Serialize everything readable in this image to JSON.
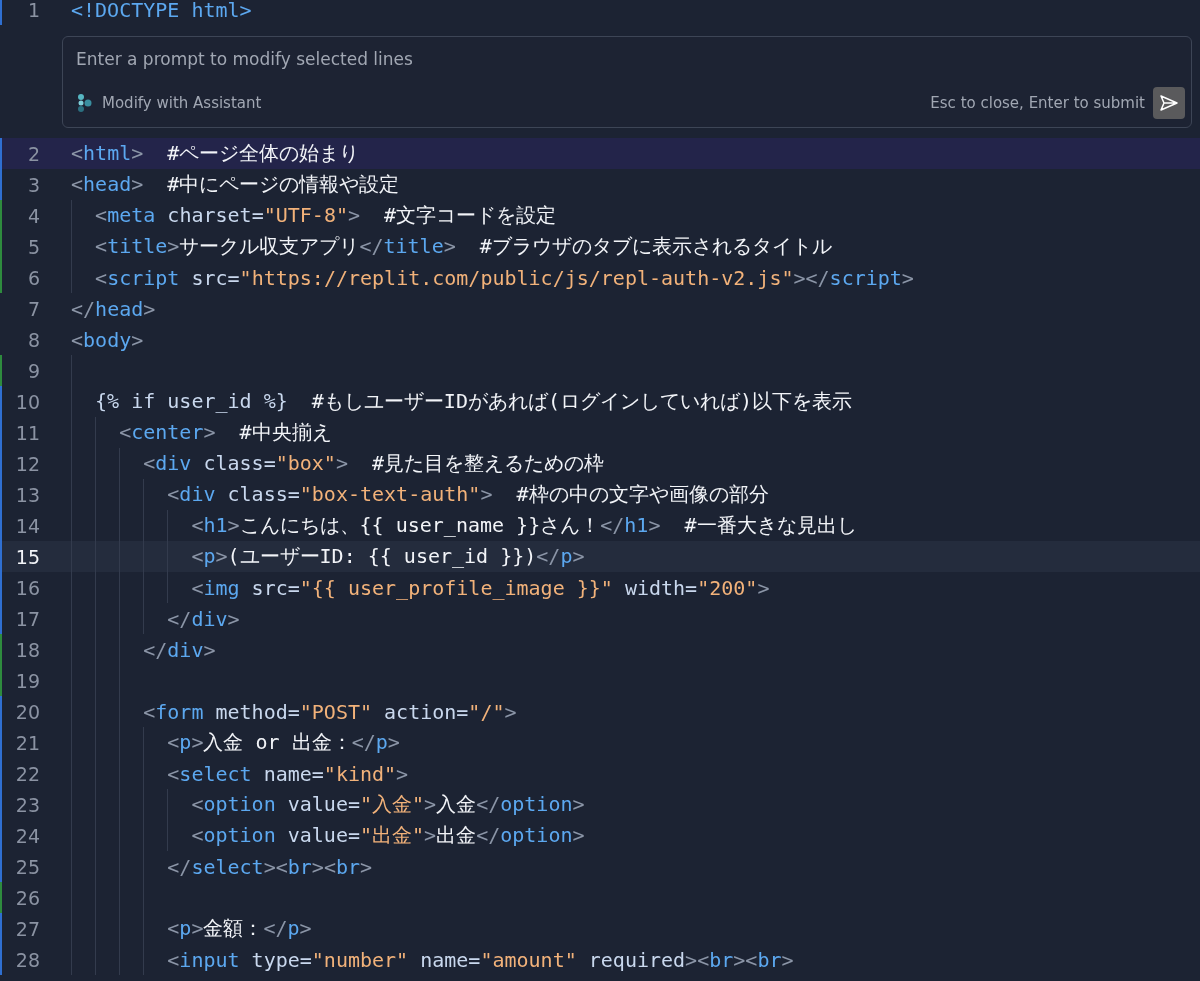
{
  "lines_before": [
    {
      "number": "1",
      "color": "#2f6fd1",
      "selected": false,
      "current": false,
      "tokens": [
        {
          "kind": "tag",
          "text": "<!DOCTYPE html>"
        }
      ]
    }
  ],
  "prompt": {
    "placeholder": "Enter a prompt to modify selected lines",
    "assistant_label": "Modify with Assistant",
    "hint": "Esc to close, Enter to submit"
  },
  "lines": [
    {
      "number": "2",
      "color": "#2f6fd1",
      "selected": true,
      "current": false,
      "tokens": [
        {
          "kind": "punct",
          "text": "<"
        },
        {
          "kind": "tag",
          "text": "html"
        },
        {
          "kind": "punct",
          "text": ">"
        },
        {
          "kind": "text",
          "text": "  #ページ全体の始まり"
        }
      ]
    },
    {
      "number": "3",
      "color": "#2f6fd1",
      "selected": false,
      "current": false,
      "tokens": [
        {
          "kind": "punct",
          "text": "<"
        },
        {
          "kind": "tag",
          "text": "head"
        },
        {
          "kind": "punct",
          "text": ">"
        },
        {
          "kind": "text",
          "text": "  #中にページの情報や設定"
        }
      ],
      "children": [
        {
          "number": "4",
          "color": "#2e8b3e",
          "selected": false,
          "current": false,
          "tokens": [
            {
              "kind": "punct",
              "text": "<"
            },
            {
              "kind": "tag",
              "text": "meta"
            },
            {
              "kind": "attr",
              "text": " charset="
            },
            {
              "kind": "string",
              "text": "\"UTF-8\""
            },
            {
              "kind": "punct",
              "text": ">"
            },
            {
              "kind": "text",
              "text": "  #文字コードを設定"
            }
          ]
        },
        {
          "number": "5",
          "color": "#2e8b3e",
          "selected": false,
          "current": false,
          "tokens": [
            {
              "kind": "punct",
              "text": "<"
            },
            {
              "kind": "tag",
              "text": "title"
            },
            {
              "kind": "punct",
              "text": ">"
            },
            {
              "kind": "text",
              "text": "サークル収支アプリ"
            },
            {
              "kind": "punct",
              "text": "</"
            },
            {
              "kind": "tag",
              "text": "title"
            },
            {
              "kind": "punct",
              "text": ">"
            },
            {
              "kind": "text",
              "text": "  #ブラウザのタブに表示されるタイトル"
            }
          ]
        },
        {
          "number": "6",
          "color": "#2e8b3e",
          "selected": false,
          "current": false,
          "tokens": [
            {
              "kind": "punct",
              "text": "<"
            },
            {
              "kind": "tag",
              "text": "script"
            },
            {
              "kind": "attr",
              "text": " src="
            },
            {
              "kind": "string",
              "text": "\"https://replit.com/public/js/repl-auth-v2.js\""
            },
            {
              "kind": "punct",
              "text": "></"
            },
            {
              "kind": "tag",
              "text": "script"
            },
            {
              "kind": "punct",
              "text": ">"
            }
          ]
        }
      ]
    },
    {
      "number": "7",
      "selected": false,
      "current": false,
      "tokens": [
        {
          "kind": "punct",
          "text": "</"
        },
        {
          "kind": "tag",
          "text": "head"
        },
        {
          "kind": "punct",
          "text": ">"
        }
      ]
    },
    {
      "number": "8",
      "selected": false,
      "current": false,
      "tokens": [
        {
          "kind": "punct",
          "text": "<"
        },
        {
          "kind": "tag",
          "text": "body"
        },
        {
          "kind": "punct",
          "text": ">"
        }
      ],
      "children": [
        {
          "number": "9",
          "color": "#2e8b3e",
          "selected": false,
          "current": false
        },
        {
          "number": "10",
          "color": "#2f6fd1",
          "selected": false,
          "current": false,
          "tokens": [
            {
              "kind": "attr",
              "text": "{% if user_id %}"
            },
            {
              "kind": "text",
              "text": "  #もしユーザーIDがあれば(ログインしていれば)以下を表示"
            }
          ],
          "children": [
            {
              "number": "11",
              "color": "#2f6fd1",
              "selected": false,
              "current": false,
              "tokens": [
                {
                  "kind": "punct",
                  "text": "<"
                },
                {
                  "kind": "tag",
                  "text": "center"
                },
                {
                  "kind": "punct",
                  "text": ">"
                },
                {
                  "kind": "text",
                  "text": "  #中央揃え"
                }
              ],
              "children": [
                {
                  "number": "12",
                  "color": "#2f6fd1",
                  "selected": false,
                  "current": false,
                  "tokens": [
                    {
                      "kind": "punct",
                      "text": "<"
                    },
                    {
                      "kind": "tag",
                      "text": "div"
                    },
                    {
                      "kind": "attr",
                      "text": " class="
                    },
                    {
                      "kind": "string",
                      "text": "\"box\""
                    },
                    {
                      "kind": "punct",
                      "text": ">"
                    },
                    {
                      "kind": "text",
                      "text": "  #見た目を整えるための枠"
                    }
                  ],
                  "children": [
                    {
                      "number": "13",
                      "color": "#2f6fd1",
                      "selected": false,
                      "current": false,
                      "tokens": [
                        {
                          "kind": "punct",
                          "text": "<"
                        },
                        {
                          "kind": "tag",
                          "text": "div"
                        },
                        {
                          "kind": "attr",
                          "text": " class="
                        },
                        {
                          "kind": "string",
                          "text": "\"box-text-auth\""
                        },
                        {
                          "kind": "punct",
                          "text": ">"
                        },
                        {
                          "kind": "text",
                          "text": "  #枠の中の文字や画像の部分"
                        }
                      ],
                      "children": [
                        {
                          "number": "14",
                          "color": "#2f6fd1",
                          "selected": false,
                          "current": false,
                          "tokens": [
                            {
                              "kind": "punct",
                              "text": "<"
                            },
                            {
                              "kind": "tag",
                              "text": "h1"
                            },
                            {
                              "kind": "punct",
                              "text": ">"
                            },
                            {
                              "kind": "text",
                              "text": "こんにちは、{{ user_name }}さん！"
                            },
                            {
                              "kind": "punct",
                              "text": "</"
                            },
                            {
                              "kind": "tag",
                              "text": "h1"
                            },
                            {
                              "kind": "punct",
                              "text": ">"
                            },
                            {
                              "kind": "text",
                              "text": "  #一番大きな見出し"
                            }
                          ]
                        },
                        {
                          "number": "15",
                          "color": "#2f6fd1",
                          "selected": false,
                          "current": true,
                          "tokens": [
                            {
                              "kind": "punct",
                              "text": "<"
                            },
                            {
                              "kind": "tag",
                              "text": "p"
                            },
                            {
                              "kind": "punct",
                              "text": ">"
                            },
                            {
                              "kind": "text",
                              "text": "(ユーザーID: {{ user_id }})"
                            },
                            {
                              "kind": "punct",
                              "text": "</"
                            },
                            {
                              "kind": "tag",
                              "text": "p"
                            },
                            {
                              "kind": "punct",
                              "text": ">"
                            }
                          ]
                        },
                        {
                          "number": "16",
                          "color": "#2f6fd1",
                          "selected": false,
                          "current": false,
                          "tokens": [
                            {
                              "kind": "punct",
                              "text": "<"
                            },
                            {
                              "kind": "tag",
                              "text": "img"
                            },
                            {
                              "kind": "attr",
                              "text": " src="
                            },
                            {
                              "kind": "string",
                              "text": "\"{{ user_profile_image }}\""
                            },
                            {
                              "kind": "attr",
                              "text": " width="
                            },
                            {
                              "kind": "string",
                              "text": "\"200\""
                            },
                            {
                              "kind": "punct",
                              "text": ">"
                            }
                          ]
                        }
                      ]
                    },
                    {
                      "number": "17",
                      "color": "#2f6fd1",
                      "selected": false,
                      "current": false,
                      "tokens": [
                        {
                          "kind": "punct",
                          "text": "</"
                        },
                        {
                          "kind": "tag",
                          "text": "div"
                        },
                        {
                          "kind": "punct",
                          "text": ">"
                        }
                      ]
                    }
                  ]
                },
                {
                  "number": "18",
                  "color": "#2e8b3e",
                  "selected": false,
                  "current": false,
                  "tokens": [
                    {
                      "kind": "punct",
                      "text": "</"
                    },
                    {
                      "kind": "tag",
                      "text": "div"
                    },
                    {
                      "kind": "punct",
                      "text": ">"
                    }
                  ]
                },
                {
                  "number": "19",
                  "color": "#2e8b3e",
                  "selected": false,
                  "current": false
                },
                {
                  "number": "20",
                  "color": "#2f6fd1",
                  "selected": false,
                  "current": false,
                  "tokens": [
                    {
                      "kind": "punct",
                      "text": "<"
                    },
                    {
                      "kind": "tag",
                      "text": "form"
                    },
                    {
                      "kind": "attr",
                      "text": " method="
                    },
                    {
                      "kind": "string",
                      "text": "\"POST\""
                    },
                    {
                      "kind": "attr",
                      "text": " action="
                    },
                    {
                      "kind": "string",
                      "text": "\"/\""
                    },
                    {
                      "kind": "punct",
                      "text": ">"
                    }
                  ],
                  "children": [
                    {
                      "number": "21",
                      "color": "#2f6fd1",
                      "selected": false,
                      "current": false,
                      "tokens": [
                        {
                          "kind": "punct",
                          "text": "<"
                        },
                        {
                          "kind": "tag",
                          "text": "p"
                        },
                        {
                          "kind": "punct",
                          "text": ">"
                        },
                        {
                          "kind": "text",
                          "text": "入金 or 出金："
                        },
                        {
                          "kind": "punct",
                          "text": "</"
                        },
                        {
                          "kind": "tag",
                          "text": "p"
                        },
                        {
                          "kind": "punct",
                          "text": ">"
                        }
                      ]
                    },
                    {
                      "number": "22",
                      "color": "#2f6fd1",
                      "selected": false,
                      "current": false,
                      "tokens": [
                        {
                          "kind": "punct",
                          "text": "<"
                        },
                        {
                          "kind": "tag",
                          "text": "select"
                        },
                        {
                          "kind": "attr",
                          "text": " name="
                        },
                        {
                          "kind": "string",
                          "text": "\"kind\""
                        },
                        {
                          "kind": "punct",
                          "text": ">"
                        }
                      ],
                      "children": [
                        {
                          "number": "23",
                          "color": "#2f6fd1",
                          "selected": false,
                          "current": false,
                          "tokens": [
                            {
                              "kind": "punct",
                              "text": "<"
                            },
                            {
                              "kind": "tag",
                              "text": "option"
                            },
                            {
                              "kind": "attr",
                              "text": " value="
                            },
                            {
                              "kind": "string",
                              "text": "\"入金\""
                            },
                            {
                              "kind": "punct",
                              "text": ">"
                            },
                            {
                              "kind": "text",
                              "text": "入金"
                            },
                            {
                              "kind": "punct",
                              "text": "</"
                            },
                            {
                              "kind": "tag",
                              "text": "option"
                            },
                            {
                              "kind": "punct",
                              "text": ">"
                            }
                          ]
                        },
                        {
                          "number": "24",
                          "color": "#2f6fd1",
                          "selected": false,
                          "current": false,
                          "tokens": [
                            {
                              "kind": "punct",
                              "text": "<"
                            },
                            {
                              "kind": "tag",
                              "text": "option"
                            },
                            {
                              "kind": "attr",
                              "text": " value="
                            },
                            {
                              "kind": "string",
                              "text": "\"出金\""
                            },
                            {
                              "kind": "punct",
                              "text": ">"
                            },
                            {
                              "kind": "text",
                              "text": "出金"
                            },
                            {
                              "kind": "punct",
                              "text": "</"
                            },
                            {
                              "kind": "tag",
                              "text": "option"
                            },
                            {
                              "kind": "punct",
                              "text": ">"
                            }
                          ]
                        }
                      ]
                    },
                    {
                      "number": "25",
                      "color": "#2f6fd1",
                      "selected": false,
                      "current": false,
                      "tokens": [
                        {
                          "kind": "punct",
                          "text": "</"
                        },
                        {
                          "kind": "tag",
                          "text": "select"
                        },
                        {
                          "kind": "punct",
                          "text": "><"
                        },
                        {
                          "kind": "tag",
                          "text": "br"
                        },
                        {
                          "kind": "punct",
                          "text": "><"
                        },
                        {
                          "kind": "tag",
                          "text": "br"
                        },
                        {
                          "kind": "punct",
                          "text": ">"
                        }
                      ]
                    },
                    {
                      "number": "26",
                      "color": "#2e8b3e",
                      "selected": false,
                      "current": false
                    },
                    {
                      "number": "27",
                      "color": "#2f6fd1",
                      "selected": false,
                      "current": false,
                      "tokens": [
                        {
                          "kind": "punct",
                          "text": "<"
                        },
                        {
                          "kind": "tag",
                          "text": "p"
                        },
                        {
                          "kind": "punct",
                          "text": ">"
                        },
                        {
                          "kind": "text",
                          "text": "金額："
                        },
                        {
                          "kind": "punct",
                          "text": "</"
                        },
                        {
                          "kind": "tag",
                          "text": "p"
                        },
                        {
                          "kind": "punct",
                          "text": ">"
                        }
                      ]
                    },
                    {
                      "number": "28",
                      "color": "#2f6fd1",
                      "selected": false,
                      "current": false,
                      "tokens": [
                        {
                          "kind": "punct",
                          "text": "<"
                        },
                        {
                          "kind": "tag",
                          "text": "input"
                        },
                        {
                          "kind": "attr",
                          "text": " type="
                        },
                        {
                          "kind": "string",
                          "text": "\"number\""
                        },
                        {
                          "kind": "attr",
                          "text": " name="
                        },
                        {
                          "kind": "string",
                          "text": "\"amount\""
                        },
                        {
                          "kind": "attr",
                          "text": " required"
                        },
                        {
                          "kind": "punct",
                          "text": "><"
                        },
                        {
                          "kind": "tag",
                          "text": "br"
                        },
                        {
                          "kind": "punct",
                          "text": "><"
                        },
                        {
                          "kind": "tag",
                          "text": "br"
                        },
                        {
                          "kind": "punct",
                          "text": ">"
                        }
                      ]
                    }
                  ]
                }
              ]
            }
          ]
        }
      ]
    }
  ]
}
